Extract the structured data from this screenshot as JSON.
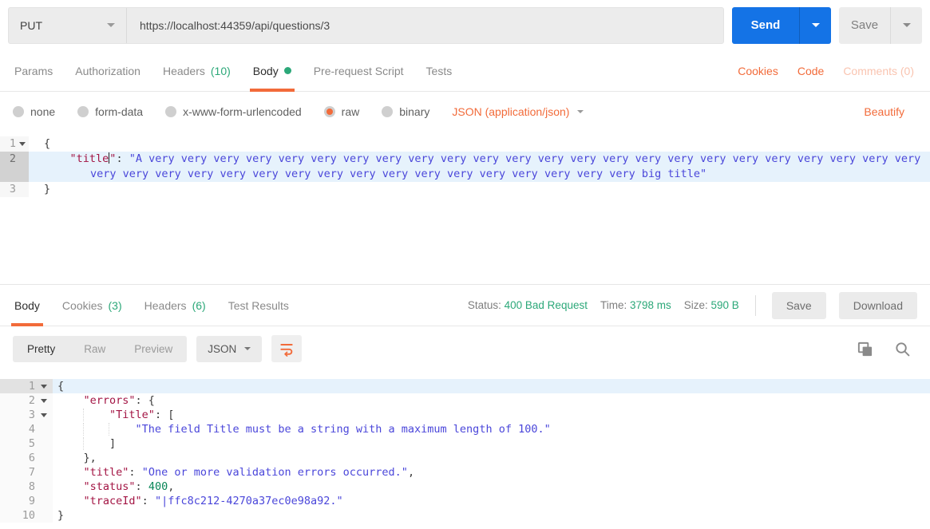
{
  "colors": {
    "accent": "#F26B3A",
    "blue": "#1473E6",
    "green": "#2CA879",
    "key": "#A31544",
    "str": "#4A46DA",
    "num": "#098658"
  },
  "request_bar": {
    "method": "PUT",
    "url": "https://localhost:44359/api/questions/3",
    "send_label": "Send",
    "save_label": "Save"
  },
  "request_tabs": {
    "items": [
      {
        "label": "Params"
      },
      {
        "label": "Authorization"
      },
      {
        "label": "Headers",
        "count": "(10)"
      },
      {
        "label": "Body",
        "active": true,
        "dot": true
      },
      {
        "label": "Pre-request Script"
      },
      {
        "label": "Tests"
      }
    ],
    "links": [
      {
        "label": "Cookies"
      },
      {
        "label": "Code"
      },
      {
        "label": "Comments (0)",
        "muted": true
      }
    ]
  },
  "body_options": {
    "radios": [
      {
        "label": "none"
      },
      {
        "label": "form-data"
      },
      {
        "label": "x-www-form-urlencoded"
      },
      {
        "label": "raw",
        "selected": true
      },
      {
        "label": "binary"
      }
    ],
    "content_type": "JSON (application/json)",
    "beautify_label": "Beautify"
  },
  "request_editor": {
    "lines": [
      {
        "num": "1",
        "fold": true,
        "tokens": [
          {
            "c": "p",
            "v": "{"
          }
        ]
      },
      {
        "num": "2",
        "active": true,
        "tokens": [
          {
            "c": "p",
            "v": "    "
          },
          {
            "c": "key",
            "v": "\"title"
          },
          {
            "c": "cursor",
            "v": ""
          },
          {
            "c": "key",
            "v": "\""
          },
          {
            "c": "p",
            "v": ": "
          },
          {
            "c": "str",
            "v": "\"A very very very very very very very very very very very very very very very very very very very very very very very very very very very very very very very very very very very very very very very very very big title\""
          }
        ]
      },
      {
        "num": "3",
        "tokens": [
          {
            "c": "p",
            "v": "}"
          }
        ]
      }
    ]
  },
  "response_meta": {
    "tabs": [
      {
        "label": "Body",
        "active": true
      },
      {
        "label": "Cookies",
        "count": "(3)"
      },
      {
        "label": "Headers",
        "count": "(6)"
      },
      {
        "label": "Test Results"
      }
    ],
    "stats": [
      {
        "label": "Status:",
        "value": "400 Bad Request"
      },
      {
        "label": "Time:",
        "value": "3798 ms"
      },
      {
        "label": "Size:",
        "value": "590 B"
      }
    ],
    "save_label": "Save",
    "download_label": "Download"
  },
  "response_toolbar": {
    "views": [
      "Pretty",
      "Raw",
      "Preview"
    ],
    "active_view": "Pretty",
    "language": "JSON"
  },
  "response_viewer": {
    "lines": [
      {
        "num": "1",
        "fold": true,
        "active": true,
        "tokens": [
          {
            "c": "p",
            "v": "{"
          }
        ]
      },
      {
        "num": "2",
        "fold": true,
        "tokens": [
          {
            "c": "ind0",
            "v": "    "
          },
          {
            "c": "key",
            "v": "\"errors\""
          },
          {
            "c": "p",
            "v": ": {"
          }
        ]
      },
      {
        "num": "3",
        "fold": true,
        "tokens": [
          {
            "c": "ind0",
            "v": "    "
          },
          {
            "c": "ind",
            "v": "    "
          },
          {
            "c": "key",
            "v": "\"Title\""
          },
          {
            "c": "p",
            "v": ": ["
          }
        ]
      },
      {
        "num": "4",
        "tokens": [
          {
            "c": "ind0",
            "v": "    "
          },
          {
            "c": "ind",
            "v": "    "
          },
          {
            "c": "ind",
            "v": "    "
          },
          {
            "c": "str",
            "v": "\"The field Title must be a string with a maximum length of 100.\""
          }
        ]
      },
      {
        "num": "5",
        "tokens": [
          {
            "c": "ind0",
            "v": "    "
          },
          {
            "c": "ind",
            "v": "    "
          },
          {
            "c": "p",
            "v": "]"
          }
        ]
      },
      {
        "num": "6",
        "tokens": [
          {
            "c": "ind0",
            "v": "    "
          },
          {
            "c": "p",
            "v": "},"
          }
        ]
      },
      {
        "num": "7",
        "tokens": [
          {
            "c": "ind0",
            "v": "    "
          },
          {
            "c": "key",
            "v": "\"title\""
          },
          {
            "c": "p",
            "v": ": "
          },
          {
            "c": "str",
            "v": "\"One or more validation errors occurred.\""
          },
          {
            "c": "p",
            "v": ","
          }
        ]
      },
      {
        "num": "8",
        "tokens": [
          {
            "c": "ind0",
            "v": "    "
          },
          {
            "c": "key",
            "v": "\"status\""
          },
          {
            "c": "p",
            "v": ": "
          },
          {
            "c": "num",
            "v": "400"
          },
          {
            "c": "p",
            "v": ","
          }
        ]
      },
      {
        "num": "9",
        "tokens": [
          {
            "c": "ind0",
            "v": "    "
          },
          {
            "c": "key",
            "v": "\"traceId\""
          },
          {
            "c": "p",
            "v": ": "
          },
          {
            "c": "str",
            "v": "\"|ffc8c212-4270a37ec0e98a92.\""
          }
        ]
      },
      {
        "num": "10",
        "tokens": [
          {
            "c": "p",
            "v": "}"
          }
        ]
      }
    ]
  }
}
